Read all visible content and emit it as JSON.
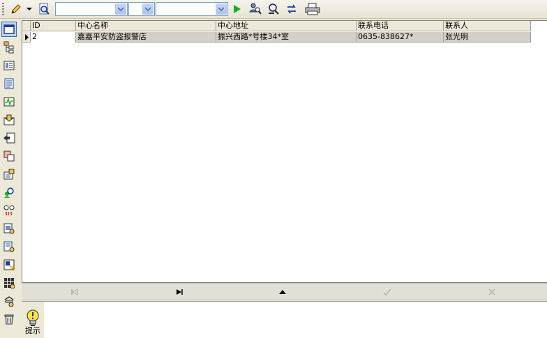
{
  "toolbar": {
    "combo1_value": "",
    "combo2_value": "",
    "combo3_value": ""
  },
  "grid": {
    "columns": [
      "ID",
      "中心名称",
      "中心地址",
      "联系电话",
      "联系人"
    ],
    "rows": [
      [
        "2",
        "嘉嘉平安防盗报警店",
        "振兴西路*号楼34*室",
        "0635-838627*",
        "张光明"
      ]
    ]
  },
  "hint": {
    "label": "提示"
  },
  "colors": {
    "accent": "#316ac5",
    "selected_row": "#d4d0c8",
    "play_green": "#1faa1f"
  }
}
